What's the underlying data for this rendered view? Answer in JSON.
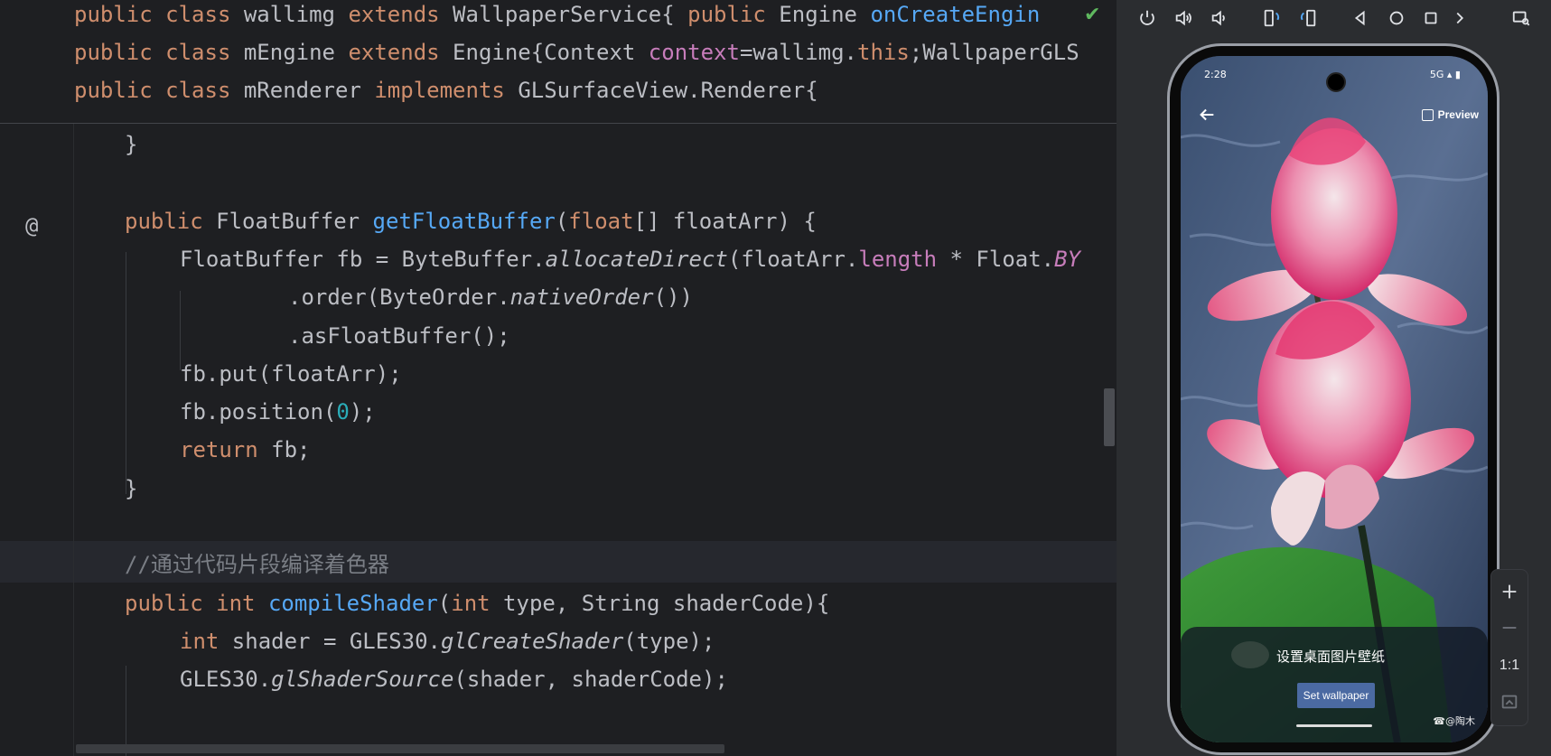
{
  "editor": {
    "sticky": [
      {
        "segments": [
          {
            "t": "public ",
            "c": "kw"
          },
          {
            "t": "class ",
            "c": "kw"
          },
          {
            "t": "wallimg ",
            "c": ""
          },
          {
            "t": "extends ",
            "c": "kw"
          },
          {
            "t": "WallpaperService{ ",
            "c": ""
          },
          {
            "t": "public ",
            "c": "kw"
          },
          {
            "t": "Engine ",
            "c": ""
          },
          {
            "t": "onCreateEngin",
            "c": "fn"
          }
        ]
      },
      {
        "segments": [
          {
            "t": "public ",
            "c": "kw"
          },
          {
            "t": "class ",
            "c": "kw"
          },
          {
            "t": "mEngine ",
            "c": ""
          },
          {
            "t": "extends ",
            "c": "kw"
          },
          {
            "t": "Engine{Context ",
            "c": ""
          },
          {
            "t": "context",
            "c": "fld"
          },
          {
            "t": "=wallimg.",
            "c": ""
          },
          {
            "t": "this",
            "c": "kw"
          },
          {
            "t": ";WallpaperGLS",
            "c": ""
          }
        ]
      },
      {
        "segments": [
          {
            "t": "public ",
            "c": "kw"
          },
          {
            "t": "class ",
            "c": "kw"
          },
          {
            "t": "mRenderer ",
            "c": ""
          },
          {
            "t": "implements ",
            "c": "kw"
          },
          {
            "t": "GLSurfaceView.Renderer{",
            "c": ""
          }
        ]
      }
    ],
    "lines": [
      {
        "indent": 142,
        "segments": [
          {
            "t": "}",
            "c": ""
          }
        ]
      },
      {
        "indent": 142,
        "segments": []
      },
      {
        "indent": 142,
        "segments": [
          {
            "t": "public ",
            "c": "kw"
          },
          {
            "t": "FloatBuffer ",
            "c": ""
          },
          {
            "t": "getFloatBuffer",
            "c": "fn"
          },
          {
            "t": "(",
            "c": ""
          },
          {
            "t": "float",
            "c": "kw"
          },
          {
            "t": "[] floatArr) {",
            "c": ""
          }
        ]
      },
      {
        "indent": 203,
        "segments": [
          {
            "t": "FloatBuffer fb = ByteBuffer.",
            "c": ""
          },
          {
            "t": "allocateDirect",
            "c": "it"
          },
          {
            "t": "(floatArr.",
            "c": ""
          },
          {
            "t": "length",
            "c": "fld"
          },
          {
            "t": " * Float.",
            "c": ""
          },
          {
            "t": "BY",
            "c": "fld it"
          }
        ]
      },
      {
        "indent": 323,
        "segments": [
          {
            "t": ".order(ByteOrder.",
            "c": ""
          },
          {
            "t": "nativeOrder",
            "c": "it"
          },
          {
            "t": "())",
            "c": ""
          }
        ]
      },
      {
        "indent": 323,
        "segments": [
          {
            "t": ".asFloatBuffer();",
            "c": ""
          }
        ]
      },
      {
        "indent": 203,
        "segments": [
          {
            "t": "fb.put(floatArr);",
            "c": ""
          }
        ]
      },
      {
        "indent": 203,
        "segments": [
          {
            "t": "fb.position(",
            "c": ""
          },
          {
            "t": "0",
            "c": "num"
          },
          {
            "t": ");",
            "c": ""
          }
        ]
      },
      {
        "indent": 203,
        "segments": [
          {
            "t": "return ",
            "c": "kw"
          },
          {
            "t": "fb;",
            "c": ""
          }
        ]
      },
      {
        "indent": 142,
        "segments": [
          {
            "t": "}",
            "c": ""
          }
        ]
      },
      {
        "indent": 142,
        "segments": []
      },
      {
        "indent": 142,
        "segments": [
          {
            "t": "//通过代码片段编译着色器",
            "c": "cmt"
          }
        ]
      },
      {
        "indent": 142,
        "segments": [
          {
            "t": "public ",
            "c": "kw"
          },
          {
            "t": "int ",
            "c": "kw"
          },
          {
            "t": "compileShader",
            "c": "fn"
          },
          {
            "t": "(",
            "c": ""
          },
          {
            "t": "int ",
            "c": "kw"
          },
          {
            "t": "type, String shaderCode){",
            "c": ""
          }
        ]
      },
      {
        "indent": 203,
        "segments": [
          {
            "t": "int ",
            "c": "kw"
          },
          {
            "t": "shader = GLES30.",
            "c": ""
          },
          {
            "t": "glCreateShader",
            "c": "it"
          },
          {
            "t": "(type);",
            "c": ""
          }
        ]
      },
      {
        "indent": 203,
        "segments": [
          {
            "t": "GLES30.",
            "c": ""
          },
          {
            "t": "glShaderSource",
            "c": "it"
          },
          {
            "t": "(shader, shaderCode);",
            "c": ""
          }
        ]
      }
    ],
    "gutter_symbol": "@"
  },
  "phone": {
    "time": "2:28",
    "network": "5G",
    "preview_label": "Preview",
    "sheet_title": "设置桌面图片壁纸",
    "set_button": "Set wallpaper",
    "watermark": "☎@陶木"
  },
  "zoom_panel": {
    "ratio_label": "1:1"
  },
  "icons": {
    "power": "power-icon",
    "volume_up": "volume-up-icon",
    "volume_down": "volume-down-icon",
    "rotate_left": "rotate-left-icon",
    "rotate_right": "rotate-right-icon",
    "back": "back-icon",
    "home": "home-icon",
    "overview": "overview-icon",
    "more": "more-icon",
    "screenshot": "screenshot-icon",
    "zoom_in": "zoom-in-icon",
    "zoom_out": "zoom-out-icon",
    "fit": "fit-screen-icon"
  },
  "colors": {
    "keyword": "#cf8e6d",
    "function": "#56a8f5",
    "field": "#c77dbb",
    "number": "#2aacb8",
    "comment": "#7a7e85",
    "text": "#bcbec4",
    "button": "#4b6aa2"
  }
}
